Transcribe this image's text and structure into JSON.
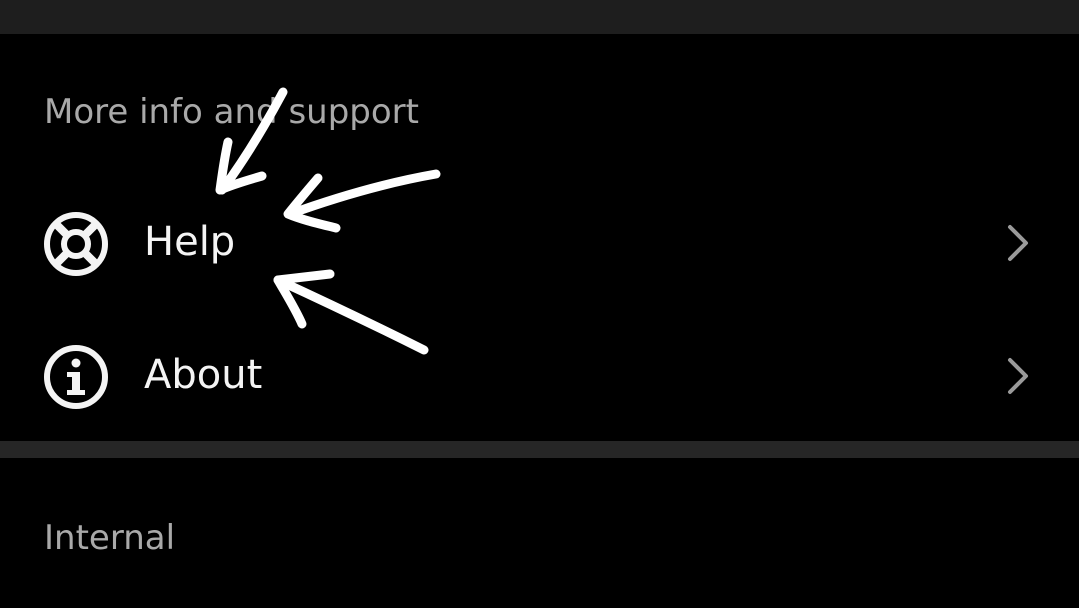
{
  "sections": [
    {
      "header": "More info and support",
      "items": [
        {
          "label": "Help",
          "icon": "lifebuoy-icon",
          "chevron": "chevron-right-icon"
        },
        {
          "label": "About",
          "icon": "info-icon",
          "chevron": "chevron-right-icon"
        }
      ]
    },
    {
      "header": "Internal"
    }
  ],
  "colors": {
    "background": "#000000",
    "divider": "#262626",
    "header_text": "#a9a9a9",
    "item_text": "#f4f4f4",
    "chevron": "#9a9a9a",
    "annotation": "#ffffff"
  }
}
